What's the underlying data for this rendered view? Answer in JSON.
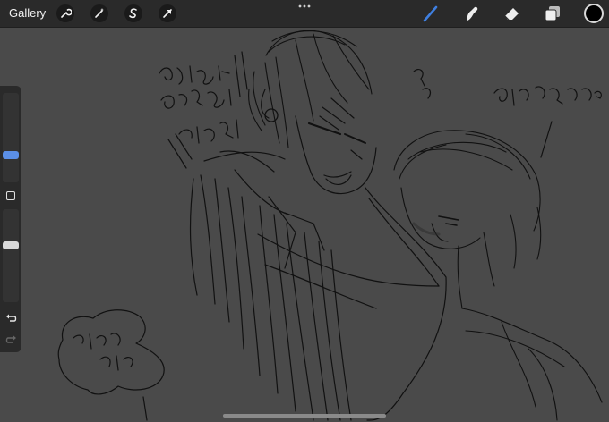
{
  "toolbar": {
    "gallery_label": "Gallery",
    "left_tools": [
      "wrench-icon",
      "magic-wand-icon",
      "selection-icon",
      "transform-arrow-icon"
    ],
    "right_tools": [
      "brush-icon",
      "smudge-icon",
      "eraser-icon",
      "layers-icon"
    ],
    "active_tool": "brush-icon",
    "accent_color": "#3f7fe0",
    "current_color": "#000000"
  },
  "sidebar": {
    "brush_size_level": 0.29,
    "opacity_level": 0.62,
    "buttons": [
      "modify-button",
      "undo-button",
      "redo-button"
    ]
  },
  "canvas": {
    "background": "#4a4a4a",
    "stroke_color": "#111111"
  }
}
